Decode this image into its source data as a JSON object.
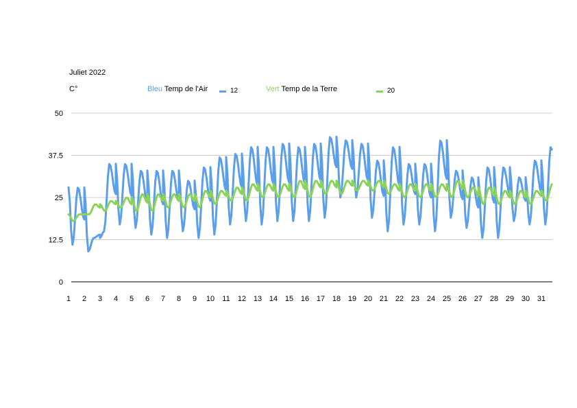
{
  "chart_data": {
    "type": "line",
    "title": "Juliet  2022",
    "ylabel": "C°",
    "ylim": [
      0,
      50
    ],
    "yticks": [
      "0",
      "12.5",
      "25",
      "37.5",
      "50"
    ],
    "x_ticks": [
      "1",
      "2",
      "3",
      "4",
      "5",
      "6",
      "7",
      "8",
      "9",
      "10",
      "11",
      "12",
      "13",
      "14",
      "15",
      "16",
      "17",
      "18",
      "19",
      "20",
      "21",
      "22",
      "23",
      "24",
      "25",
      "26",
      "27",
      "28",
      "29",
      "30",
      "31"
    ],
    "legend": {
      "air_color_word": "Bleu",
      "air_label": "Temp de l'Air",
      "air_value": "12",
      "ground_color_word": "Vert",
      "ground_label": "Temp de la Terre",
      "ground_value": "20"
    },
    "colors": {
      "air": "#5b9ee9",
      "ground": "#8ad35a",
      "grid": "#cccccc",
      "axis": "#000000"
    },
    "series": [
      {
        "key": "air",
        "daily_min": [
          11,
          9,
          15,
          17,
          16,
          14,
          13,
          15,
          13,
          14,
          17,
          18,
          17,
          18,
          18,
          18,
          19,
          25,
          25,
          19,
          15,
          17,
          17,
          15,
          19,
          16,
          13,
          13,
          18,
          17,
          17
        ],
        "daily_max": [
          28,
          13,
          35,
          35,
          33,
          33,
          33,
          30,
          34,
          37,
          38,
          40,
          40,
          41,
          40,
          41,
          43,
          42,
          41,
          36,
          40,
          35,
          35,
          42,
          33,
          31,
          34,
          34,
          31,
          36,
          40
        ]
      },
      {
        "key": "ground",
        "daily_min": [
          18,
          20,
          21,
          22,
          21,
          21,
          22,
          22,
          22,
          23,
          24,
          24,
          25,
          25,
          25,
          25,
          26,
          26,
          27,
          27,
          26,
          25,
          25,
          25,
          25,
          25,
          23,
          23,
          23,
          23,
          24
        ],
        "daily_max": [
          20,
          23,
          24,
          25,
          26,
          26,
          26,
          26,
          27,
          27,
          28,
          29,
          29,
          29,
          30,
          30,
          30,
          30,
          30,
          30,
          29,
          29,
          29,
          29,
          30,
          28,
          28,
          27,
          27,
          27,
          29
        ]
      }
    ]
  }
}
